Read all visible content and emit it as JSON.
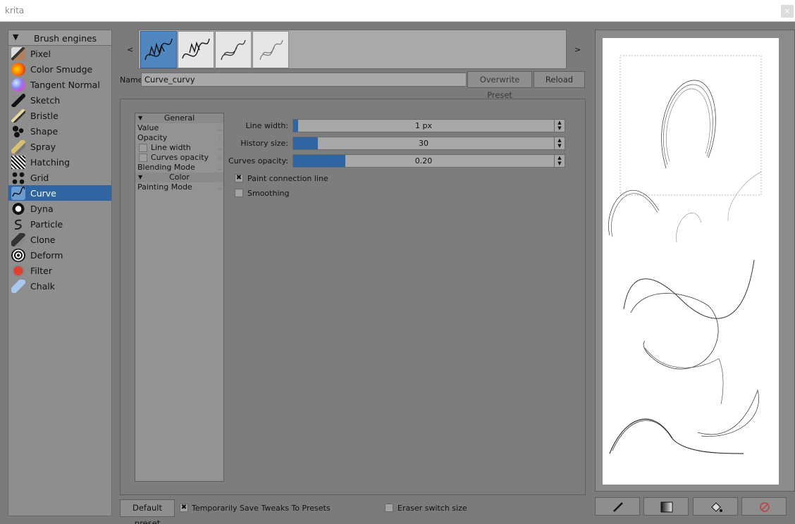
{
  "window": {
    "title": "krita",
    "close_label": "×"
  },
  "engines": {
    "header": "Brush engines",
    "items": [
      {
        "label": "Pixel"
      },
      {
        "label": "Color Smudge"
      },
      {
        "label": "Tangent Normal"
      },
      {
        "label": "Sketch"
      },
      {
        "label": "Bristle"
      },
      {
        "label": "Shape"
      },
      {
        "label": "Spray"
      },
      {
        "label": "Hatching"
      },
      {
        "label": "Grid"
      },
      {
        "label": "Curve"
      },
      {
        "label": "Dyna"
      },
      {
        "label": "Particle"
      },
      {
        "label": "Clone"
      },
      {
        "label": "Deform"
      },
      {
        "label": "Filter"
      },
      {
        "label": "Chalk"
      }
    ],
    "selected": "Curve"
  },
  "presets": {
    "prev_label": "<",
    "next_label": ">"
  },
  "name_row": {
    "label": "Name:",
    "value": "Curve_curvy",
    "overwrite_label": "Overwrite Preset",
    "reload_label": "Reload"
  },
  "options": {
    "general_header": "General",
    "value": "Value",
    "opacity": "Opacity",
    "line_width": "Line width",
    "curves_opacity": "Curves opacity",
    "blending_mode": "Blending Mode",
    "color_header": "Color",
    "painting_mode": "Painting Mode"
  },
  "settings": {
    "line_width": {
      "label": "Line width:",
      "value": "1 px",
      "fraction": 0.003
    },
    "history_size": {
      "label": "History size:",
      "value": "30",
      "fraction": 0.095
    },
    "curves_opacity": {
      "label": "Curves opacity:",
      "value": "0.20",
      "fraction": 0.2
    },
    "paint_connection_line": {
      "label": "Paint connection line",
      "checked": true
    },
    "smoothing": {
      "label": "Smoothing",
      "checked": false
    }
  },
  "footer": {
    "default_preset_label": "Default preset",
    "temp_save_label": "Temporarily Save Tweaks To Presets",
    "temp_save_checked": true,
    "eraser_switch_label": "Eraser switch size",
    "eraser_switch_checked": false
  },
  "check_mark": "✖",
  "scratchpad_tools": [
    "brush-icon",
    "gradient-icon",
    "fill-icon",
    "clear-icon"
  ],
  "colors": {
    "accent": "#2f65a3"
  }
}
